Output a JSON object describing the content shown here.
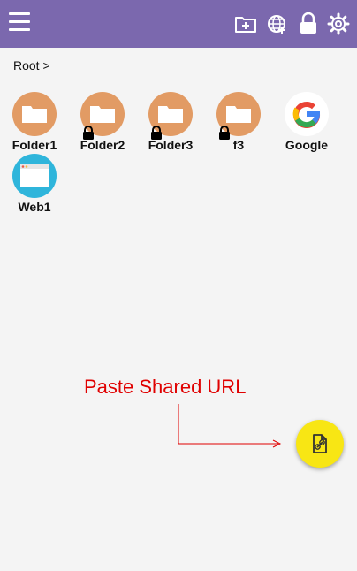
{
  "header": {
    "accent_color": "#7b68ae",
    "icons": [
      "menu-icon",
      "new-folder-icon",
      "globe-icon",
      "lock-icon",
      "gear-icon"
    ]
  },
  "breadcrumb": {
    "text": "Root >"
  },
  "items": [
    {
      "label": "Folder1",
      "type": "folder",
      "locked": false
    },
    {
      "label": "Folder2",
      "type": "folder",
      "locked": true
    },
    {
      "label": "Folder3",
      "type": "folder",
      "locked": true
    },
    {
      "label": "f3",
      "type": "folder",
      "locked": true
    },
    {
      "label": "Google",
      "type": "google",
      "locked": false
    },
    {
      "label": "Web1",
      "type": "web",
      "locked": false
    }
  ],
  "annotation": {
    "text": "Paste Shared URL",
    "color": "#e00000"
  },
  "fab": {
    "icon": "paste-link-icon",
    "color": "#f8e614"
  }
}
